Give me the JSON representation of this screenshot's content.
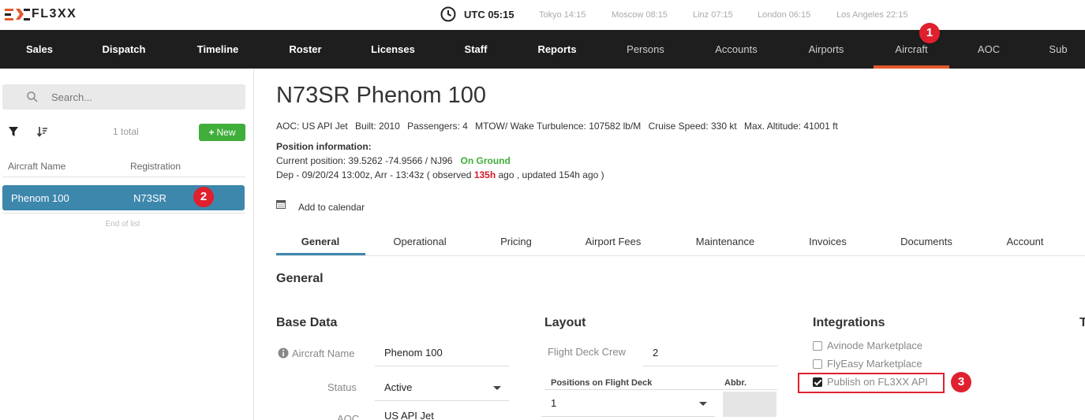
{
  "header": {
    "logo_text": "FL3XX",
    "utc_label": "UTC 05:15",
    "cities": [
      "Tokyo 14:15",
      "Moscow 08:15",
      "Linz 07:15",
      "London 06:15",
      "Los Angeles 22:15"
    ]
  },
  "nav": {
    "items": [
      "Sales",
      "Dispatch",
      "Timeline",
      "Roster",
      "Licenses",
      "Staff",
      "Reports",
      "Persons",
      "Accounts",
      "Airports",
      "Aircraft",
      "AOC",
      "Sub"
    ],
    "active": "Aircraft",
    "accent_color": "#e4582b"
  },
  "badges": [
    "1",
    "2",
    "3"
  ],
  "sidebar": {
    "search_placeholder": "Search...",
    "total": "1 total",
    "new_button": "New",
    "col_name": "Aircraft Name",
    "col_registration": "Registration",
    "rows": [
      {
        "name": "Phenom 100",
        "registration": "N73SR"
      }
    ],
    "end_of_list": "End of list"
  },
  "aircraft": {
    "title": "N73SR Phenom 100",
    "aoc": "AOC: US API Jet",
    "built": "Built: 2010",
    "passengers": "Passengers: 4",
    "mtow": "MTOW/ Wake Turbulence: 107582 lb/M",
    "cruise": "Cruise Speed: 330 kt",
    "altitude": "Max. Altitude: 41001 ft",
    "position_header": "Position information:",
    "current_position": "Current position: 39.5262 -74.9566 / NJ96",
    "status": "On Ground",
    "dep_prefix": "Dep - 09/20/24 13:00z, Arr - 13:43z ( observed ",
    "observed": "135h",
    "dep_suffix": " ago , updated 154h ago )",
    "add_to_calendar": "Add to calendar"
  },
  "tabs": [
    "General",
    "Operational",
    "Pricing",
    "Airport Fees",
    "Maintenance",
    "Invoices",
    "Documents",
    "Account"
  ],
  "general": {
    "section_title": "General",
    "base_data": {
      "title": "Base Data",
      "aircraft_name_label": "Aircraft Name",
      "aircraft_name_value": "Phenom 100",
      "status_label": "Status",
      "status_value": "Active",
      "aoc_label": "AOC",
      "aoc_value": "US API Jet"
    },
    "layout": {
      "title": "Layout",
      "flight_deck_crew_label": "Flight Deck Crew",
      "flight_deck_crew_value": "2",
      "positions_header": "Positions on Flight Deck",
      "abbr_header": "Abbr.",
      "position_value": "1"
    },
    "integrations": {
      "title": "Integrations",
      "items": [
        {
          "label": "Avinode Marketplace",
          "checked": false
        },
        {
          "label": "FlyEasy Marketplace",
          "checked": false
        },
        {
          "label": "Publish on FL3XX API",
          "checked": true
        }
      ]
    },
    "cut_title": "T"
  }
}
